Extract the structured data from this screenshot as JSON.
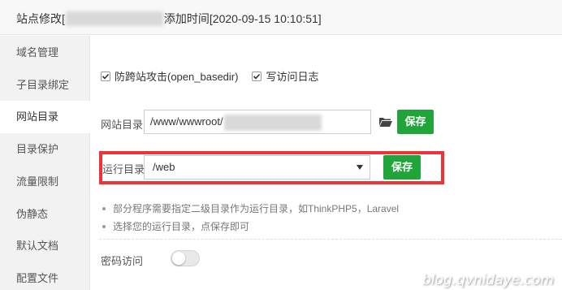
{
  "header": {
    "title_prefix": "站点修改[",
    "title_suffix": "添加时间[2020-09-15 10:10:51]"
  },
  "sidebar": {
    "items": [
      {
        "label": "域名管理"
      },
      {
        "label": "子目录绑定"
      },
      {
        "label": "网站目录",
        "active": true
      },
      {
        "label": "目录保护"
      },
      {
        "label": "流量限制"
      },
      {
        "label": "伪静态"
      },
      {
        "label": "默认文档"
      },
      {
        "label": "配置文件"
      }
    ]
  },
  "main": {
    "checkboxes": [
      {
        "label": "防跨站攻击(open_basedir)",
        "checked": true
      },
      {
        "label": "写访问日志",
        "checked": true
      }
    ],
    "site_dir": {
      "label": "网站目录",
      "value": "/www/wwwroot/",
      "folder_icon": "folder-icon",
      "save_label": "保存"
    },
    "run_dir": {
      "label": "运行目录",
      "selected": "/web",
      "save_label": "保存"
    },
    "tips": [
      "部分程序需要指定二级目录作为运行目录，如ThinkPHP5，Laravel",
      "选择您的运行目录，点保存即可"
    ],
    "password_access": {
      "label": "密码访问",
      "enabled": false
    }
  },
  "watermark": "blog.qvnidaye.com",
  "colors": {
    "accent_green": "#20a53a",
    "highlight_red": "#ee3338"
  }
}
